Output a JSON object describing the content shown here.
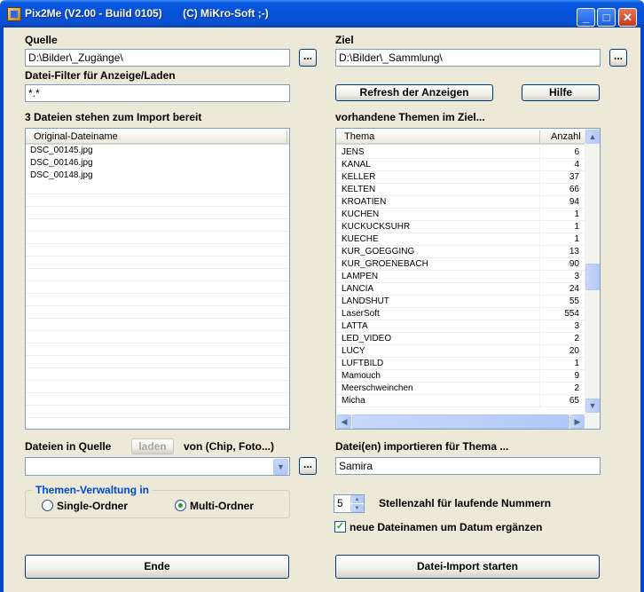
{
  "window": {
    "title": "Pix2Me (V2.00 - Build 0105)       (C) MiKro-Soft ;-)",
    "minimize": "_",
    "maximize": "□",
    "close": "✕"
  },
  "source": {
    "label": "Quelle",
    "path": "D:\\Bilder\\_Zugänge\\",
    "browse": "..."
  },
  "target": {
    "label": "Ziel",
    "path": "D:\\Bilder\\_Sammlung\\",
    "browse": "..."
  },
  "filter": {
    "label": "Datei-Filter für Anzeige/Laden",
    "value": "*.*"
  },
  "buttons": {
    "refresh": "Refresh der Anzeigen",
    "help": "Hilfe",
    "end": "Ende",
    "start_import": "Datei-Import starten",
    "load": "laden"
  },
  "files": {
    "count_label": "3 Dateien stehen zum Import bereit",
    "column": "Original-Dateiname",
    "items": [
      "DSC_00145.jpg",
      "DSC_00146.jpg",
      "DSC_00148.jpg"
    ]
  },
  "themes": {
    "label": "vorhandene Themen im Ziel...",
    "col_theme": "Thema",
    "col_count": "Anzahl",
    "rows": [
      {
        "name": "JENS",
        "count": "6"
      },
      {
        "name": "KANAL",
        "count": "4"
      },
      {
        "name": "KELLER",
        "count": "37"
      },
      {
        "name": "KELTEN",
        "count": "66"
      },
      {
        "name": "KROATIEN",
        "count": "94"
      },
      {
        "name": "KUCHEN",
        "count": "1"
      },
      {
        "name": "KUCKUCKSUHR",
        "count": "1"
      },
      {
        "name": "KUECHE",
        "count": "1"
      },
      {
        "name": "KUR_GOEGGING",
        "count": "13"
      },
      {
        "name": "KUR_GROENEBACH",
        "count": "90"
      },
      {
        "name": "LAMPEN",
        "count": "3"
      },
      {
        "name": "LANCIA",
        "count": "24"
      },
      {
        "name": "LANDSHUT",
        "count": "55"
      },
      {
        "name": "LaserSoft",
        "count": "554"
      },
      {
        "name": "LATTA",
        "count": "3"
      },
      {
        "name": "LED_VIDEO",
        "count": "2"
      },
      {
        "name": "LUCY",
        "count": "20"
      },
      {
        "name": "LUFTBILD",
        "count": "1"
      },
      {
        "name": "Mamouch",
        "count": "9"
      },
      {
        "name": "Meerschweinchen",
        "count": "2"
      },
      {
        "name": "Micha",
        "count": "65"
      }
    ]
  },
  "source_files": {
    "label_prefix": "Dateien in Quelle",
    "label_suffix": "von (Chip, Foto...)",
    "value": "",
    "browse": "..."
  },
  "import_theme": {
    "label": "Datei(en) importieren für Thema ...",
    "value": "Samira"
  },
  "theme_mgmt": {
    "title": "Themen-Verwaltung in",
    "single": "Single-Ordner",
    "multi": "Multi-Ordner",
    "selected": "multi"
  },
  "numbering": {
    "value": "5",
    "label": "Stellenzahl für laufende Nummern"
  },
  "date_option": {
    "checked": true,
    "label": "neue Dateinamen um Datum ergänzen"
  },
  "colors": {
    "titlebar": "#0552d8",
    "client": "#ece9d8",
    "group_title": "#0046d5"
  }
}
